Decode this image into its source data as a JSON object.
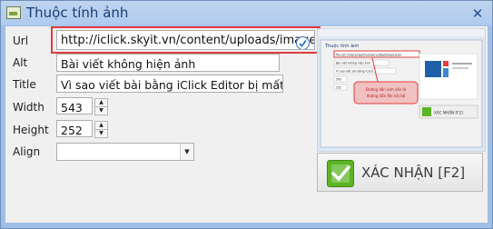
{
  "window": {
    "title": "Thuộc tính ảnh",
    "close_glyph": "✕"
  },
  "form": {
    "url": {
      "label": "Url",
      "value": "http://iclick.skyit.vn/content/uploads/images/b"
    },
    "alt": {
      "label": "Alt",
      "value": "Bài viết không hiện ảnh"
    },
    "title": {
      "label": "Title",
      "value": "Vì sao viết bài bằng iClick Editor bị mất ảnh"
    },
    "width": {
      "label": "Width",
      "value": "543"
    },
    "height": {
      "label": "Height",
      "value": "252"
    },
    "align": {
      "label": "Align",
      "value": ""
    }
  },
  "preview": {
    "mini_title": "Thuộc tính ảnh",
    "mini_url": "file:///C:/Users/ngochuongnvs/AppData/Local/",
    "mini_alt": "Bài viết không hiện ảnh",
    "mini_title_text": "Vì sao viết bài bằng iClick...",
    "mini_width": "543",
    "mini_height": "252",
    "callout_line1": "Đường dẫn ảnh vẫn là",
    "callout_line2": "đường dẫn file nội bộ",
    "mini_confirm": "XÁC NHẬN [F2]"
  },
  "actions": {
    "confirm_label": "XÁC NHẬN [F2]"
  },
  "colors": {
    "accent": "#e23c3c",
    "ok": "#5cb524",
    "title": "#1b3d74"
  }
}
